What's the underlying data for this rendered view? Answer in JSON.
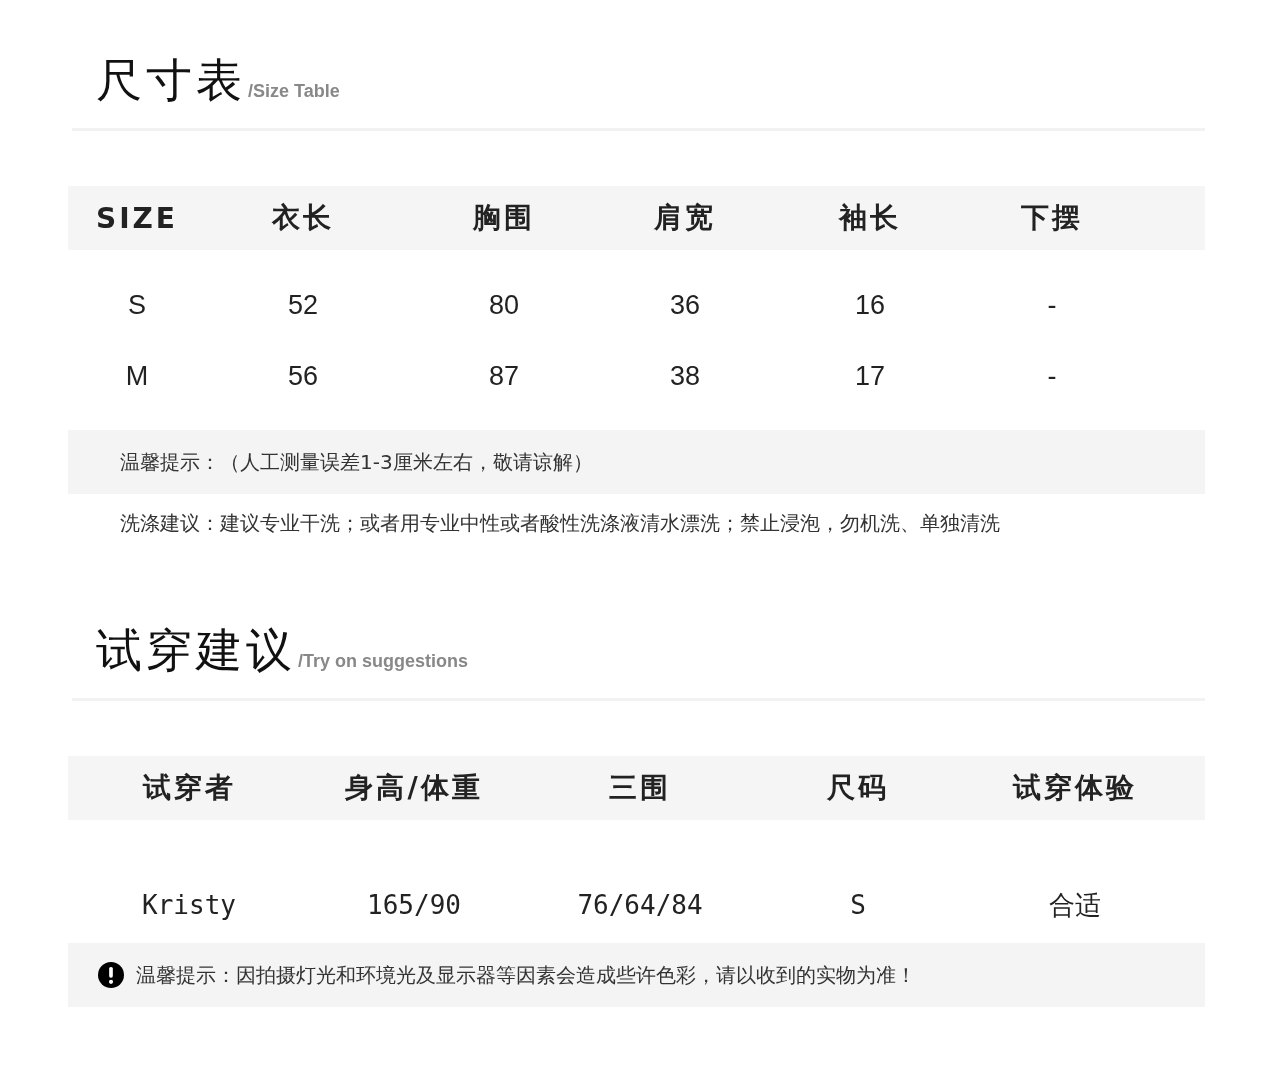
{
  "size_section": {
    "title": "尺寸表",
    "subtitle": "/Size Table",
    "table": {
      "columns": [
        "SIZE",
        "衣长",
        "胸围",
        "肩宽",
        "袖长",
        "下摆"
      ],
      "rows": [
        [
          "S",
          "52",
          "80",
          "36",
          "16",
          "-"
        ],
        [
          "M",
          "56",
          "87",
          "38",
          "17",
          "-"
        ]
      ]
    },
    "notes": [
      {
        "kind": "shaded",
        "text": "温馨提示：（人工测量误差1-3厘米左右，敬请谅解）"
      },
      {
        "kind": "plain",
        "text": "洗涤建议：建议专业干洗；或者用专业中性或者酸性洗涤液清水漂洗；禁止浸泡，勿机洗、单独清洗"
      }
    ]
  },
  "try_section": {
    "title": "试穿建议",
    "subtitle": "/Try on suggestions",
    "table": {
      "columns": [
        "试穿者",
        "身高/体重",
        "三围",
        "尺码",
        "试穿体验"
      ],
      "rows": [
        [
          "Kristy",
          "165/90",
          "76/64/84",
          "S",
          "合适"
        ]
      ]
    },
    "notice": "温馨提示：因拍摄灯光和环境光及显示器等因素会造成些许色彩，请以收到的实物为准！"
  }
}
